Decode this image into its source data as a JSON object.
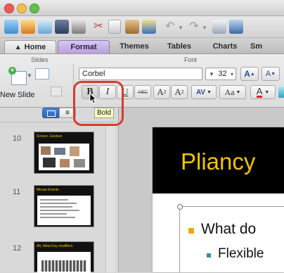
{
  "colors": {
    "close": "#ee5a52",
    "minimize": "#f4bf4f",
    "maximize": "#5ec24b",
    "accent_format_tab": "#b9a0df",
    "slide_title_text": "#f3c300",
    "bullet": "#f0a70f",
    "callout_outline": "#d43c2e"
  },
  "ribbon": {
    "tabs": [
      {
        "label": "Home",
        "icon": "home-icon"
      },
      {
        "label": "Format"
      },
      {
        "label": "Themes"
      },
      {
        "label": "Tables"
      },
      {
        "label": "Charts"
      },
      {
        "label": "Sm"
      }
    ],
    "groups": {
      "slides": "Slides",
      "font": "Font"
    },
    "new_slide_label": "New Slide",
    "font_name": "Corbel",
    "font_size": "32",
    "increase_font": "A",
    "decrease_font": "A",
    "bold": "B",
    "italic": "I",
    "underline": "U",
    "strikethrough": "ABC",
    "superscript": "A",
    "subscript": "A",
    "char_spacing": "AV",
    "change_case": "Aa",
    "font_color": "A"
  },
  "tooltip": "Bold",
  "slides": [
    {
      "number": "10",
      "title": "Screen, Gesture"
    },
    {
      "number": "11",
      "title": "Mouse Events"
    },
    {
      "number": "12",
      "title": "Alt, Meta Key modifiers"
    }
  ],
  "main_slide": {
    "title": "Pliancy",
    "bullet1": "What do",
    "bullet2": "Flexible"
  }
}
